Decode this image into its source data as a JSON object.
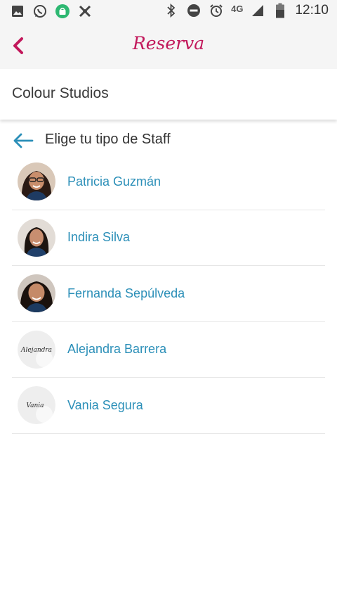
{
  "status_bar": {
    "left_icons": [
      "image-icon",
      "whatsapp-icon",
      "android-store-icon",
      "tool-icon"
    ],
    "right_icons": [
      "bluetooth-icon",
      "dnd-icon",
      "alarm-icon"
    ],
    "network": "4G",
    "time": "12:10"
  },
  "app_bar": {
    "back_icon": "chevron-left-icon",
    "title": "Reserva",
    "accent_color": "#c2185b"
  },
  "studio": {
    "name": "Colour Studios"
  },
  "section": {
    "back_icon": "arrow-left-icon",
    "title": "Elige tu tipo de Staff"
  },
  "staff": [
    {
      "name": "Patricia Guzmán",
      "avatar": "photo"
    },
    {
      "name": "Indira Silva",
      "avatar": "photo"
    },
    {
      "name": "Fernanda Sepúlveda",
      "avatar": "photo"
    },
    {
      "name": "Alejandra Barrera",
      "avatar": "signature",
      "signature_text": "Alejandra"
    },
    {
      "name": "Vania Segura",
      "avatar": "signature",
      "signature_text": "Vania"
    }
  ],
  "colors": {
    "link": "#2b8fb8",
    "app_bar_bg": "#f5f5f5"
  }
}
